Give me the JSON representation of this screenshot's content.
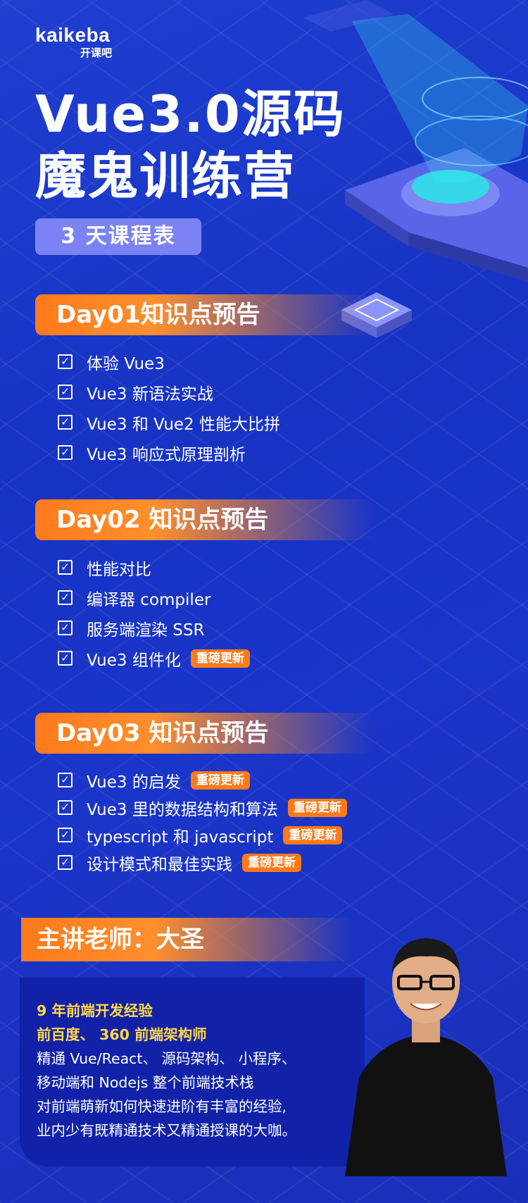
{
  "brand": {
    "name": "kaikeba",
    "sub": "开课吧"
  },
  "title": {
    "line1": "Vue3.0源码",
    "line2": "魔鬼训练营"
  },
  "schedule_label": "3 天课程表",
  "badge_label": "重磅更新",
  "days": [
    {
      "heading": "Day01知识点预告",
      "items": [
        "体验 Vue3",
        "Vue3 新语法实战",
        "Vue3 和 Vue2 性能大比拼",
        "Vue3 响应式原理剖析"
      ],
      "badges": [
        false,
        false,
        false,
        false
      ]
    },
    {
      "heading": "Day02 知识点预告",
      "items": [
        "性能对比",
        "编译器 compiler",
        "服务端渲染 SSR",
        "Vue3 组件化"
      ],
      "badges": [
        false,
        false,
        false,
        true
      ]
    },
    {
      "heading": "Day03 知识点预告",
      "items": [
        "Vue3 的启发",
        "Vue3 里的数据结构和算法",
        "typescript 和 javascript",
        "设计模式和最佳实践"
      ],
      "badges": [
        true,
        true,
        true,
        true
      ]
    }
  ],
  "teacher": {
    "heading": "主讲老师：大圣",
    "highlights": [
      "9 年前端开发经验",
      "前百度、 360 前端架构师"
    ],
    "bio": [
      "精通 Vue/React、 源码架构、 小程序、",
      "移动端和 Nodejs 整个前端技术栈",
      "对前端萌新如何快速进阶有丰富的经验,",
      "业内少有既精通技术又精通授课的大咖。"
    ]
  },
  "colors": {
    "orange": "#ff7a1a",
    "highlight": "#ffd84a",
    "pill": "#7b83f4",
    "background": "#1a35c9"
  }
}
